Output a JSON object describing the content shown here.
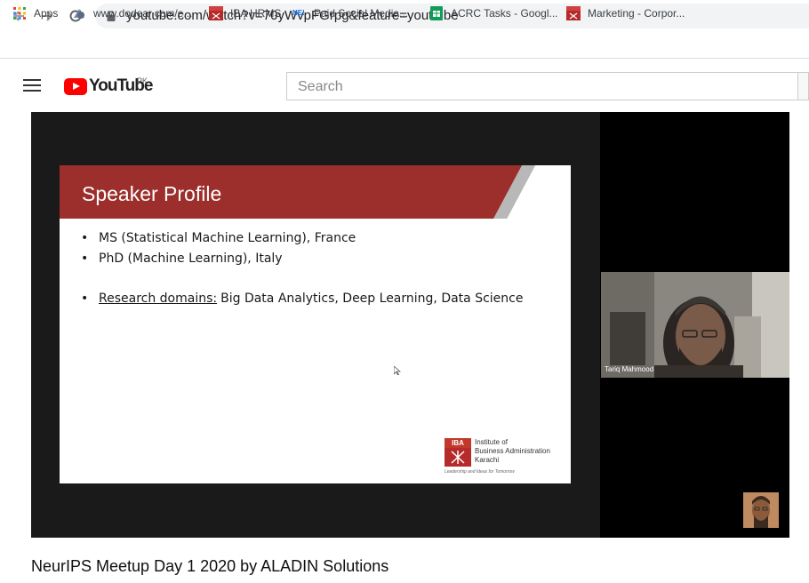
{
  "browser": {
    "url": "youtube.com/watch?v=70yWvpFGrpg&feature=youtu.be",
    "nav_icons": [
      "back-arrow-icon",
      "forward-arrow-icon",
      "reload-icon",
      "lock-icon"
    ],
    "bookmarks": [
      {
        "label": "Apps",
        "icon": "apps-grid-icon"
      },
      {
        "label": "www.dodear.com/e...",
        "icon": "site-globe-icon"
      },
      {
        "label": "IBA HRMS",
        "icon": "iba-icon"
      },
      {
        "label": "Paid Social Media...",
        "icon": "ne-icon",
        "icon_text": "NE!"
      },
      {
        "label": "ACRC Tasks - Googl...",
        "icon": "sheets-icon"
      },
      {
        "label": "Marketing - Corpor...",
        "icon": "iba-icon"
      }
    ]
  },
  "youtube": {
    "logo_text": "YouTube",
    "country_code": "PK",
    "search_placeholder": "Search"
  },
  "video": {
    "slide": {
      "title": "Speaker Profile",
      "bullets": [
        {
          "prefix": "",
          "text": "MS (Statistical Machine Learning), France"
        },
        {
          "prefix": "",
          "text": "PhD (Machine Learning), Italy"
        },
        {
          "prefix": "Research domains:",
          "text": "Big Data Analytics, Deep Learning, Data Science"
        }
      ],
      "institute": {
        "mark": "IBA",
        "lines": [
          "Institute of",
          "Business Administration",
          "Karachi"
        ],
        "tagline": "Leadership and Ideas for Tomorrow"
      }
    },
    "speaker_name": "Tariq Mahmood",
    "title": "NeurIPS Meetup Day 1 2020 by ALADIN Solutions"
  },
  "colors": {
    "slide_banner": "#9c2e2b",
    "youtube_red": "#ff0000",
    "iba_red": "#c0392b"
  }
}
